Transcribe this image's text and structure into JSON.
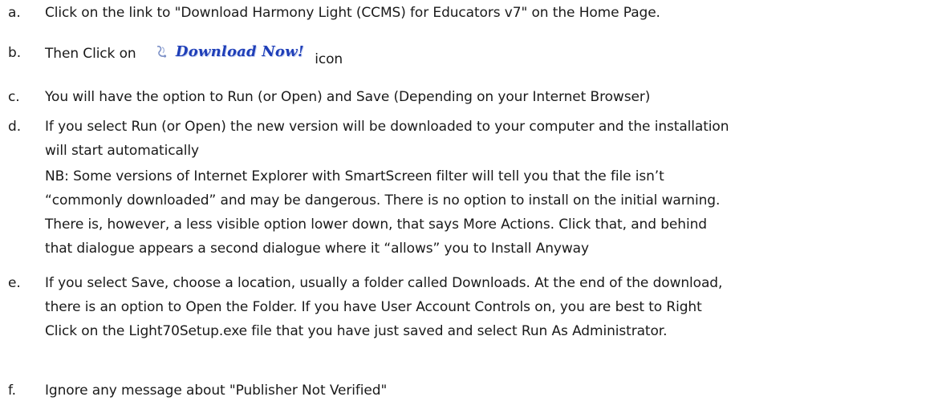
{
  "steps": [
    {
      "letter": "a.",
      "lines": [
        "Click on the link to \"Download Harmony Light (CCMS) for Educators v7\" on the Home Page."
      ]
    },
    {
      "letter": "b.",
      "before": "Then Click on",
      "badge": {
        "icon": "swirl-icon",
        "text": "Download Now!",
        "color": "#1f3fb8"
      },
      "after": "icon"
    },
    {
      "letter": "c.",
      "lines": [
        "You will have the option to Run (or Open) and Save (Depending on your Internet Browser)"
      ]
    },
    {
      "letter": "d.",
      "lines": [
        "If you select Run (or Open) the new version will be downloaded to your computer and the installation",
        "will start automatically",
        "NB: Some versions of Internet Explorer with SmartScreen filter will tell you that the file isn’t",
        "“commonly downloaded” and may be dangerous. There is no option to install on the initial warning.",
        "There is, however, a less visible option lower down, that says More Actions. Click that, and behind",
        "that dialogue appears a second dialogue where it “allows” you to Install Anyway"
      ]
    },
    {
      "letter": "e.",
      "lines": [
        "If you select Save, choose a location, usually a folder called Downloads. At the end of the download,",
        "there is an option to Open the Folder. If you have User Account Controls on, you are best to Right",
        "Click on the Light70Setup.exe file that you have just saved and select Run As Administrator."
      ]
    },
    {
      "letter": "f.",
      "lines": [
        "Ignore any message about \"Publisher Not Verified\""
      ]
    }
  ]
}
